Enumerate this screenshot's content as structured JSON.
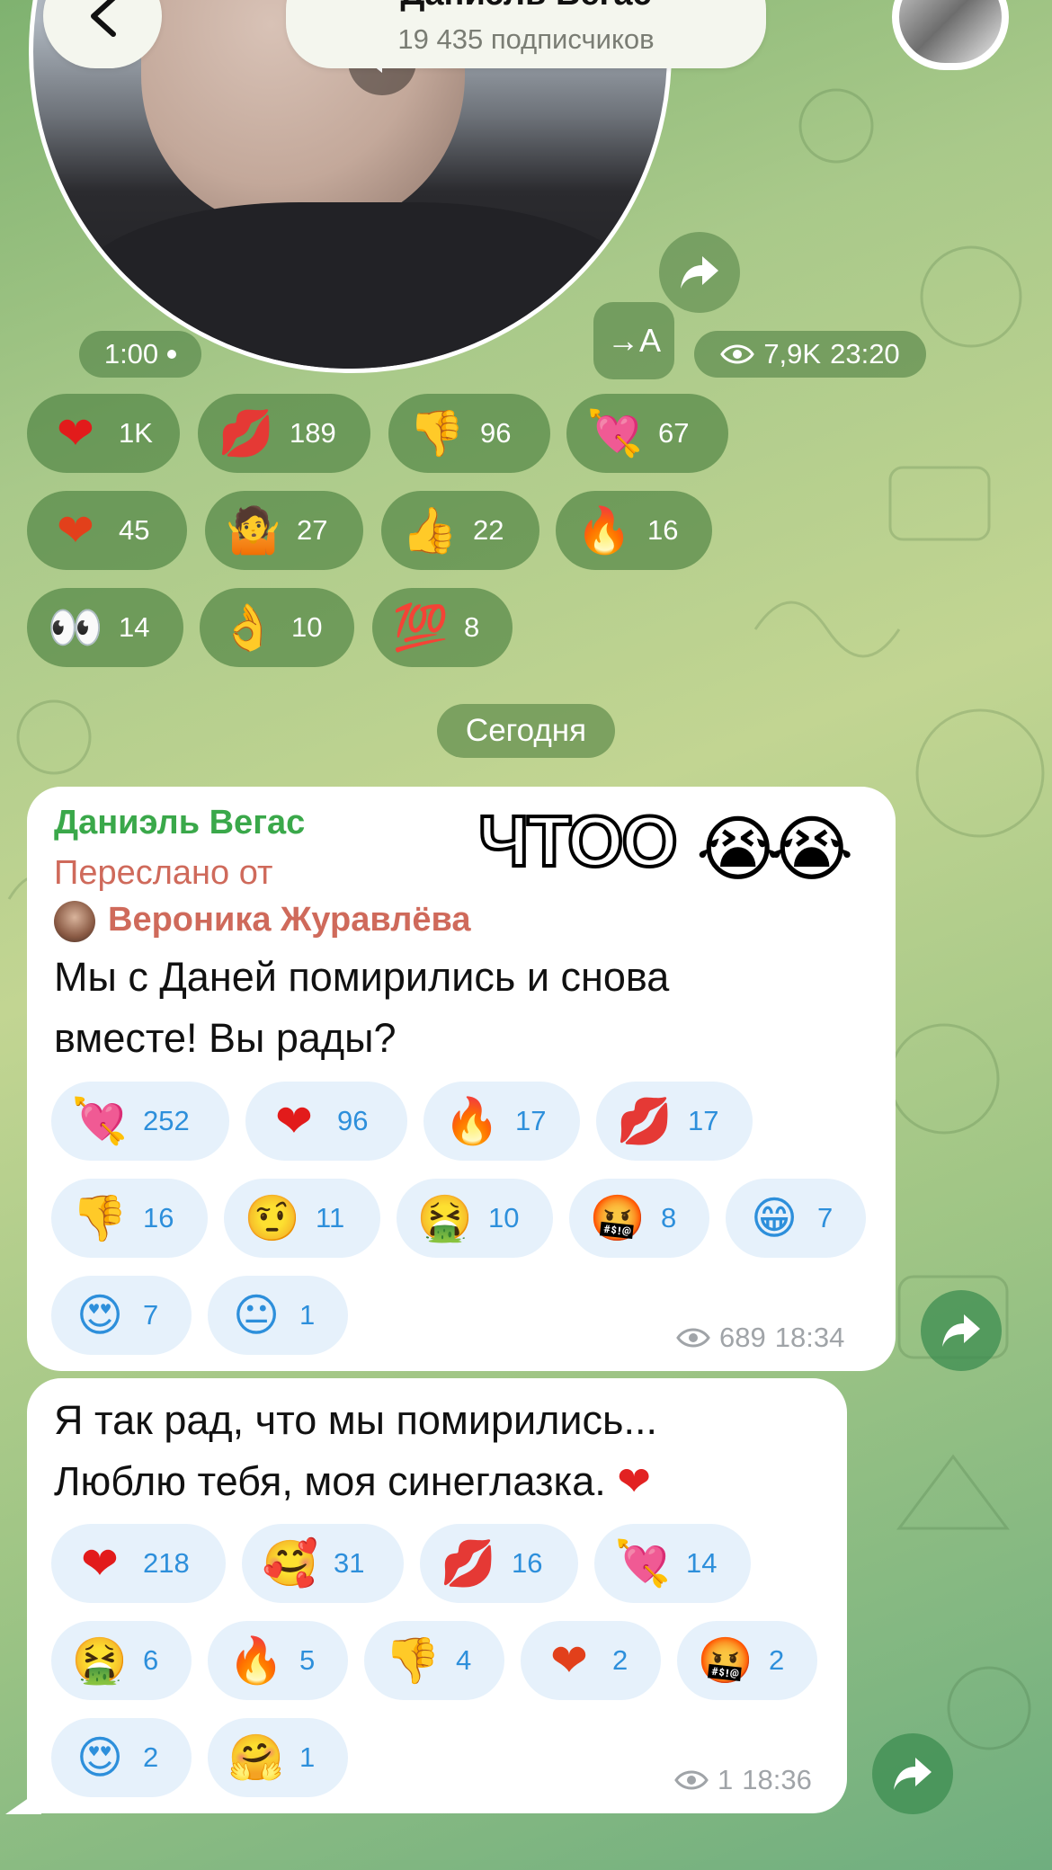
{
  "header": {
    "title": "Даниэль Вегас",
    "subscribers": "19 435 подписчиков"
  },
  "video_note": {
    "duration": "1:00",
    "views": "7,9K",
    "time": "23:20",
    "translate_label": "→A",
    "reactions": [
      {
        "icon": "heart",
        "emoji": "❤",
        "count": "1K"
      },
      {
        "icon": "kiss-lips",
        "emoji": "💋",
        "count": "189"
      },
      {
        "icon": "thumbs-down",
        "emoji": "👎",
        "count": "96"
      },
      {
        "icon": "heart-arrow",
        "emoji": "💘",
        "count": "67"
      },
      {
        "icon": "heart-on-fire",
        "emoji": "❤",
        "count": "45"
      },
      {
        "icon": "shrug",
        "emoji": "🤷",
        "count": "27"
      },
      {
        "icon": "thumbs-up",
        "emoji": "👍",
        "count": "22"
      },
      {
        "icon": "fire",
        "emoji": "🔥",
        "count": "16"
      },
      {
        "icon": "eyes",
        "emoji": "👀",
        "count": "14"
      },
      {
        "icon": "ok-hand",
        "emoji": "👌",
        "count": "10"
      },
      {
        "icon": "hundred",
        "emoji": "💯",
        "count": "8"
      }
    ]
  },
  "date_separator": "Сегодня",
  "message1": {
    "author": "Даниэль Вегас",
    "forwarded_label": "Переслано от",
    "forwarded_from": "Вероника Журавлёва",
    "sticker_text": "ЧТОО",
    "sticker_emoji": "😭",
    "line1": "Мы с Даней помирились и снова",
    "line2": "вместе! Вы рады?",
    "views": "689",
    "time": "18:34",
    "reactions": [
      {
        "icon": "heart-arrow",
        "emoji": "💘",
        "count": "252"
      },
      {
        "icon": "heart",
        "emoji": "❤",
        "count": "96"
      },
      {
        "icon": "fire",
        "emoji": "🔥",
        "count": "17"
      },
      {
        "icon": "kiss-lips",
        "emoji": "💋",
        "count": "17"
      },
      {
        "icon": "thumbs-down",
        "emoji": "👎",
        "count": "16"
      },
      {
        "icon": "raised-eyebrow",
        "emoji": "🤨",
        "count": "11"
      },
      {
        "icon": "vomit",
        "emoji": "🤮",
        "count": "10"
      },
      {
        "icon": "cursing-face",
        "emoji": "🤬",
        "count": "8"
      },
      {
        "icon": "grin",
        "emoji": "😁",
        "count": "7"
      },
      {
        "icon": "heart-eyes",
        "emoji": "😍",
        "count": "7"
      },
      {
        "icon": "neutral-face",
        "emoji": "😐",
        "count": "1"
      }
    ]
  },
  "message2": {
    "line1": "Я так рад, что мы помирились...",
    "line2": "Люблю тебя, моя синеглазка.",
    "line2_emoji": "❤",
    "views": "1",
    "time": "18:36",
    "reactions": [
      {
        "icon": "heart",
        "emoji": "❤",
        "count": "218"
      },
      {
        "icon": "smiling-hearts",
        "emoji": "🥰",
        "count": "31"
      },
      {
        "icon": "kiss-lips",
        "emoji": "💋",
        "count": "16"
      },
      {
        "icon": "heart-arrow",
        "emoji": "💘",
        "count": "14"
      },
      {
        "icon": "vomit",
        "emoji": "🤮",
        "count": "6"
      },
      {
        "icon": "fire",
        "emoji": "🔥",
        "count": "5"
      },
      {
        "icon": "thumbs-down",
        "emoji": "👎",
        "count": "4"
      },
      {
        "icon": "heart-on-fire",
        "emoji": "❤",
        "count": "2"
      },
      {
        "icon": "cursing-face",
        "emoji": "🤬",
        "count": "2"
      },
      {
        "icon": "heart-eyes",
        "emoji": "😍",
        "count": "2"
      },
      {
        "icon": "hugging-face",
        "emoji": "🤗",
        "count": "1"
      }
    ]
  },
  "colors": {
    "author": "#3aa84a",
    "forwarded": "#cf6a5b",
    "reaction_count": "#2d8fdb"
  }
}
